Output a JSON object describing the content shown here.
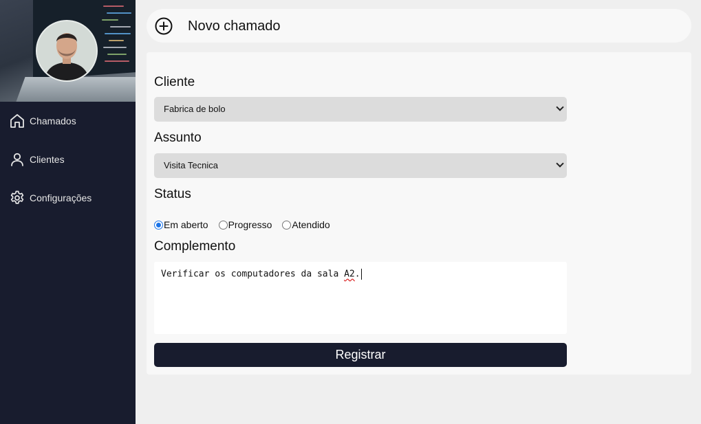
{
  "sidebar": {
    "items": [
      {
        "label": "Chamados",
        "icon": "home-icon"
      },
      {
        "label": "Clientes",
        "icon": "user-icon"
      },
      {
        "label": "Configurações",
        "icon": "gear-icon"
      }
    ]
  },
  "header": {
    "title": "Novo chamado",
    "icon": "plus-circle-icon"
  },
  "form": {
    "cliente_label": "Cliente",
    "cliente_value": "Fabrica de bolo",
    "assunto_label": "Assunto",
    "assunto_value": "Visita Tecnica",
    "status_label": "Status",
    "status_options": [
      "Em aberto",
      "Progresso",
      "Atendido"
    ],
    "status_selected": "Em aberto",
    "complemento_label": "Complemento",
    "complemento_text_before": "Verificar os computadores da sala ",
    "complemento_text_flagged": "A2",
    "complemento_text_after": ".",
    "submit_label": "Registrar"
  },
  "colors": {
    "sidebar_bg": "#181c2e",
    "page_bg": "#efefef",
    "card_bg": "#f8f8f8",
    "select_bg": "#dcdcdc",
    "button_bg": "#181c2e",
    "radio_accent": "#1a73e8"
  }
}
